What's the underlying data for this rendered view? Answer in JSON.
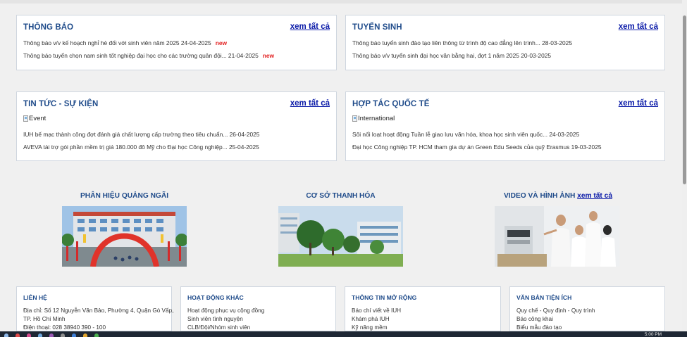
{
  "announcements": {
    "title": "THÔNG BÁO",
    "see_all": "xem tất cả",
    "items": [
      {
        "text": "Thông báo v/v kế hoạch nghỉ hè đối với sinh viên năm 2025 24-04-2025",
        "badge": "new"
      },
      {
        "text": "Thông báo tuyển chọn nam sinh tốt nghiệp đại học cho các trường quân đội... 21-04-2025",
        "badge": "new"
      }
    ]
  },
  "admissions": {
    "title": "TUYỂN SINH",
    "see_all": "xem tất cả",
    "items": [
      {
        "text": "Thông báo tuyển sinh đào tạo liên thông từ trình độ cao đẳng lên trình... 28-03-2025"
      },
      {
        "text": "Thông báo v/v tuyển sinh đại học văn bằng hai, đợt 1 năm 2025 20-03-2025"
      }
    ]
  },
  "news": {
    "title": "TIN TỨC - SỰ KIỆN",
    "see_all": "xem tất cả",
    "image_alt": "Event",
    "items": [
      {
        "text": "IUH bế mạc thành công đợt đánh giá chất lượng cấp trường theo tiêu chuẩn... 26-04-2025"
      },
      {
        "text": "AVEVA tài trợ gói phần mềm trị giá 180.000 đô Mỹ cho Đại học Công nghiệp... 25-04-2025"
      }
    ]
  },
  "international": {
    "title": "HỢP TÁC QUỐC TẾ",
    "see_all": "xem tất cả",
    "image_alt": "International",
    "items": [
      {
        "text": "Sôi nổi loạt hoạt động Tuần lễ giao lưu văn hóa, khoa học sinh viên quốc... 24-03-2025"
      },
      {
        "text": "Đại học Công nghiệp TP. HCM tham gia dự án Green Edu Seeds của quỹ Erasmus 19-03-2025"
      }
    ]
  },
  "campuses": {
    "quang_ngai": {
      "title": "PHÂN HIỆU QUẢNG NGÃI"
    },
    "thanh_hoa": {
      "title": "CƠ SỞ THANH HÓA"
    },
    "media": {
      "title": "VIDEO VÀ HÌNH ẢNH",
      "see_all": "xem tất cả"
    }
  },
  "footer": {
    "contact": {
      "title": "LIÊN HỆ",
      "lines": [
        "Địa chỉ: Số 12 Nguyễn Văn Bảo, Phường 4, Quận Gò Vấp,",
        "TP. Hồ Chí Minh",
        "Điện thoại: 028 38940 390 - 100"
      ]
    },
    "activities": {
      "title": "HOẠT ĐỘNG KHÁC",
      "lines": [
        "Hoạt động phục vụ cộng đồng",
        "Sinh viên tình nguyện",
        "CLB/Đội/Nhóm sinh viên"
      ]
    },
    "extended": {
      "title": "THÔNG TIN MỞ RỘNG",
      "lines": [
        "Báo chí viết về IUH",
        "Khám phá IUH",
        "Kỹ năng mềm"
      ]
    },
    "documents": {
      "title": "VĂN BẢN TIỆN ÍCH",
      "lines": [
        "Quy chế - Quy định - Quy trình",
        "Báo công khai",
        "Biểu mẫu đào tạo"
      ]
    }
  },
  "taskbar": {
    "clock": "5:00 PM"
  },
  "colors": {
    "heading": "#1f4b8a",
    "link": "#0a1aa8",
    "new_badge": "#e21d1d",
    "border": "#cfd6df"
  }
}
